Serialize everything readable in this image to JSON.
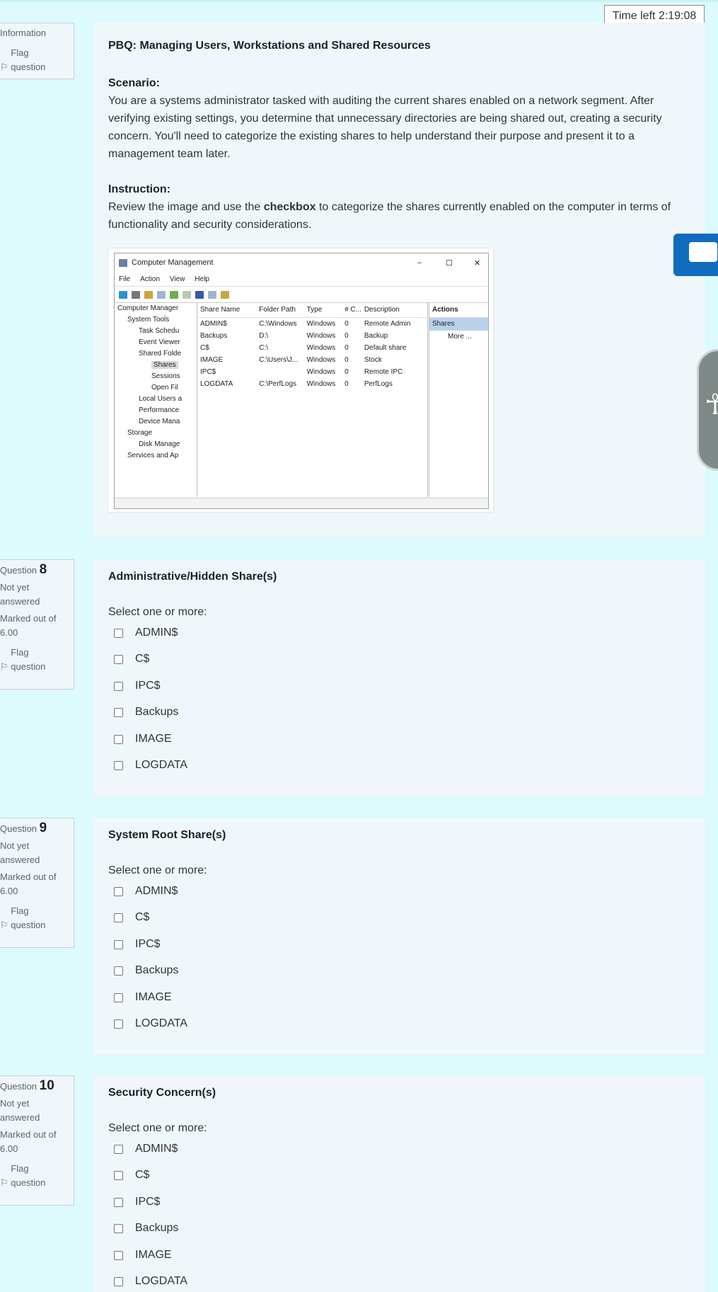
{
  "timer": "Time left 2:19:08",
  "intro": {
    "info_label": "Information",
    "flag_label": "Flag question",
    "title": "PBQ: Managing Users, Workstations and Shared Resources",
    "scenario_label": "Scenario:",
    "scenario_text": "You are a systems administrator tasked with auditing the current shares enabled on a network segment. After verifying existing settings, you determine that unnecessary directories are being shared out, creating a security concern. You'll need to categorize the existing shares to help understand their purpose and present it to a management team later.",
    "instruction_label": "Instruction:",
    "instruction_before": "Review the image and use the ",
    "instruction_bold": "checkbox",
    "instruction_after": " to categorize the shares currently enabled on the computer in terms of functionality and security considerations."
  },
  "screenshot": {
    "window_title": "Computer Management",
    "menu": [
      "File",
      "Action",
      "View",
      "Help"
    ],
    "tree": [
      "Computer Manager",
      "System Tools",
      "Task Schedu",
      "Event Viewer",
      "Shared Folde",
      "Shares",
      "Sessions",
      "Open Fil",
      "Local Users a",
      "Performance",
      "Device Mana",
      "Storage",
      "Disk Manage",
      "Services and Ap"
    ],
    "columns": [
      "Share Name",
      "Folder Path",
      "Type",
      "# C...",
      "Description"
    ],
    "rows": [
      [
        "ADMIN$",
        "C:\\Windows",
        "Windows",
        "0",
        "Remote Admin"
      ],
      [
        "Backups",
        "D:\\",
        "Windows",
        "0",
        "Backup"
      ],
      [
        "C$",
        "C:\\",
        "Windows",
        "0",
        "Default share"
      ],
      [
        "IMAGE",
        "C:\\Users\\J...",
        "Windows",
        "0",
        "Stock"
      ],
      [
        "IPC$",
        "",
        "Windows",
        "0",
        "Remote IPC"
      ],
      [
        "LOGDATA",
        "C:\\PerfLogs",
        "Windows",
        "0",
        "PerfLogs"
      ]
    ],
    "actions_header": "Actions",
    "actions_shares": "Shares",
    "actions_more": "More ..."
  },
  "questions": [
    {
      "q_prefix": "Question",
      "number": "8",
      "status": "Not yet answered",
      "marks": "Marked out of 6.00",
      "flag": "Flag question",
      "title": "Administrative/Hidden Share(s)",
      "prompt": "Select one or more:",
      "options": [
        "ADMIN$",
        "C$",
        "IPC$",
        "Backups",
        "IMAGE",
        "LOGDATA"
      ]
    },
    {
      "q_prefix": "Question",
      "number": "9",
      "status": "Not yet answered",
      "marks": "Marked out of 6.00",
      "flag": "Flag question",
      "title": "System Root Share(s)",
      "prompt": "Select one or more:",
      "options": [
        "ADMIN$",
        "C$",
        "IPC$",
        "Backups",
        "IMAGE",
        "LOGDATA"
      ]
    },
    {
      "q_prefix": "Question",
      "number": "10",
      "status": "Not yet answered",
      "marks": "Marked out of 6.00",
      "flag": "Flag question",
      "title": "Security Concern(s)",
      "prompt": "Select one or more:",
      "options": [
        "ADMIN$",
        "C$",
        "IPC$",
        "Backups",
        "IMAGE",
        "LOGDATA"
      ]
    }
  ],
  "colors": {
    "page_bg": "#ddfafc",
    "card_bg": "#f0f7fa",
    "chat_button": "#0f6cbf",
    "accessibility_button": "#7f8a88"
  },
  "icons": [
    "flag-icon",
    "chat-icon",
    "accessibility-icon"
  ]
}
